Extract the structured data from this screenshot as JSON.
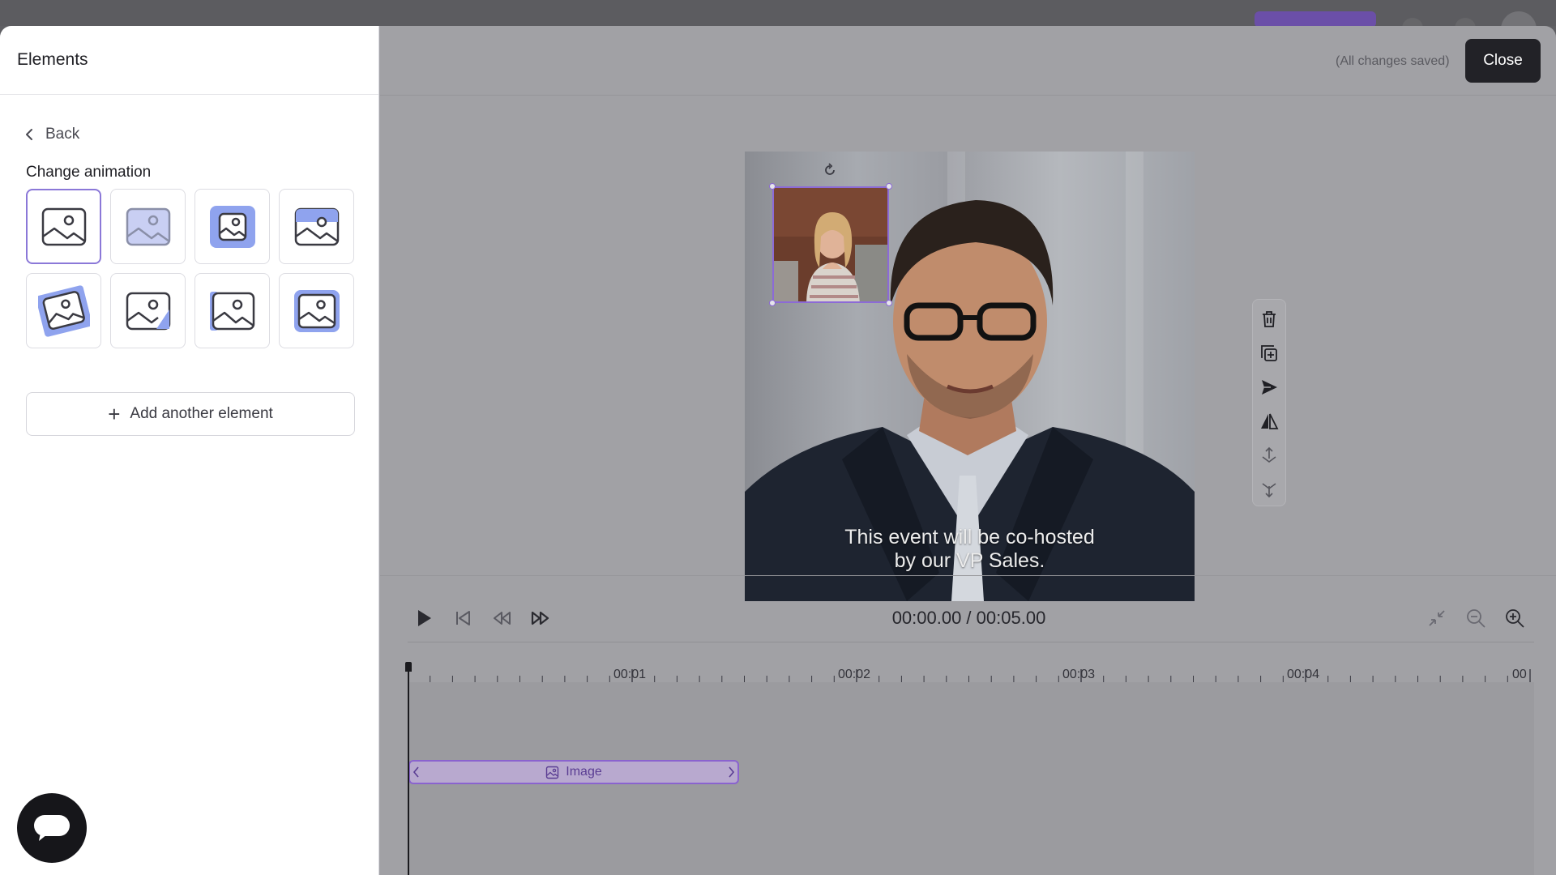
{
  "panel": {
    "title": "Elements",
    "back_label": "Back",
    "section_label": "Change animation",
    "add_button_label": "Add another element",
    "animations": [
      {
        "style": "plain",
        "selected": true
      },
      {
        "style": "fade",
        "selected": false
      },
      {
        "style": "filled",
        "selected": false
      },
      {
        "style": "top-band",
        "selected": false
      },
      {
        "style": "rotated",
        "selected": false
      },
      {
        "style": "corner-wipe",
        "selected": false
      },
      {
        "style": "side-wipe",
        "selected": false
      },
      {
        "style": "framed",
        "selected": false
      }
    ]
  },
  "header": {
    "saved_status": "(All changes saved)",
    "close_label": "Close"
  },
  "canvas": {
    "caption_line1": "This event will be co-hosted",
    "caption_line2": "by our VP Sales."
  },
  "toolbar": {
    "tools": [
      "delete-icon",
      "duplicate-icon",
      "send-icon",
      "flip-icon",
      "bring-forward-icon",
      "send-backward-icon"
    ]
  },
  "player": {
    "timecode": "00:00.00 / 00:05.00"
  },
  "timeline": {
    "tick_labels": [
      "00:01",
      "00:02",
      "00:03",
      "00:04",
      "00"
    ],
    "clip_label": "Image"
  },
  "colors": {
    "accent": "#8b78d8",
    "tile_fill": "#8fa3ee",
    "dark_button": "#222227"
  }
}
